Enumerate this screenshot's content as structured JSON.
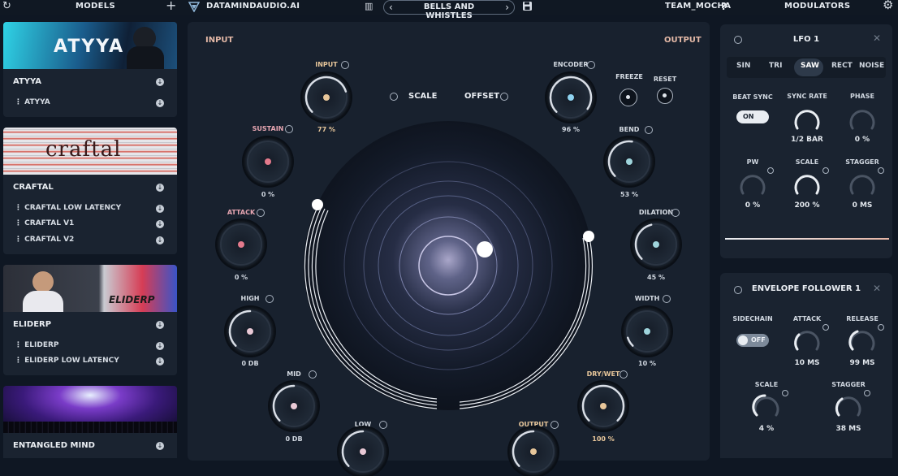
{
  "topbar": {
    "models_title": "MODELS",
    "brand": "DATAMINDAUDIO.AI",
    "preset_name": "BELLS AND WHISTLES",
    "user": "TEAM_MOCHA",
    "help": "?",
    "modulators_title": "MODULATORS"
  },
  "models": [
    {
      "name": "ATYYA",
      "image_text": "ATYYA",
      "subs": [
        "ATYYA"
      ]
    },
    {
      "name": "CRAFTAL",
      "image_text": "craftal",
      "subs": [
        "CRAFTAL LOW LATENCY",
        "CRAFTAL V1",
        "CRAFTAL V2"
      ]
    },
    {
      "name": "ELIDERP",
      "image_text": "ELIDERP",
      "subs": [
        "ELIDERP",
        "ELIDERP LOW LATENCY"
      ]
    },
    {
      "name": "ENTANGLED MIND",
      "subs": []
    }
  ],
  "center": {
    "input_label": "INPUT",
    "output_label": "OUTPUT",
    "scale_label": "SCALE",
    "offset_label": "OFFSET",
    "freeze_label": "FREEZE",
    "reset_label": "RESET",
    "knobs": {
      "input": {
        "label": "INPUT",
        "value": "77 %",
        "level": 0.77,
        "color": "#e7c69a"
      },
      "sustain": {
        "label": "SUSTAIN",
        "value": "0 %",
        "level": 0.0,
        "color": "#e47a8c"
      },
      "attack": {
        "label": "ATTACK",
        "value": "0 %",
        "level": 0.0,
        "color": "#e47a8c"
      },
      "high": {
        "label": "HIGH",
        "value": "0 DB",
        "level": 0.5,
        "color": "#e9c9d6"
      },
      "mid": {
        "label": "MID",
        "value": "0 DB",
        "level": 0.5,
        "color": "#e9c9d6"
      },
      "low": {
        "label": "LOW",
        "value": "",
        "level": 0.5,
        "color": "#e9c9d6"
      },
      "encoder": {
        "label": "ENCODER",
        "value": "96 %",
        "level": 0.96,
        "color": "#8fd3f0"
      },
      "bend": {
        "label": "BEND",
        "value": "53 %",
        "level": 0.53,
        "color": "#9fd4dc"
      },
      "dilation": {
        "label": "DILATION",
        "value": "45 %",
        "level": 0.45,
        "color": "#9fd4dc"
      },
      "width": {
        "label": "WIDTH",
        "value": "10 %",
        "level": 0.1,
        "color": "#9fd4dc"
      },
      "drywet": {
        "label": "DRY/WET",
        "value": "100 %",
        "level": 1.0,
        "color": "#e7c69a"
      },
      "output": {
        "label": "OUTPUT",
        "value": "",
        "level": 0.5,
        "color": "#e7c69a"
      }
    }
  },
  "lfo": {
    "title": "LFO 1",
    "waveforms": [
      "SIN",
      "TRI",
      "SAW",
      "RECT",
      "NOISE"
    ],
    "selected_waveform": "SAW",
    "beat_sync_label": "BEAT SYNC",
    "beat_sync_state": "ON",
    "sync_rate_label": "SYNC RATE",
    "sync_rate_value": "1/2 BAR",
    "phase_label": "PHASE",
    "phase_value": "0 %",
    "pw_label": "PW",
    "pw_value": "0 %",
    "scale_label": "SCALE",
    "scale_value": "200 %",
    "stagger_label": "STAGGER",
    "stagger_value": "0 MS"
  },
  "envelope": {
    "title": "ENVELOPE FOLLOWER 1",
    "sidechain_label": "SIDECHAIN",
    "sidechain_state": "OFF",
    "attack_label": "ATTACK",
    "attack_value": "10 MS",
    "release_label": "RELEASE",
    "release_value": "99 MS",
    "scale_label": "SCALE",
    "scale_value": "4 %",
    "stagger_label": "STAGGER",
    "stagger_value": "38 MS"
  }
}
